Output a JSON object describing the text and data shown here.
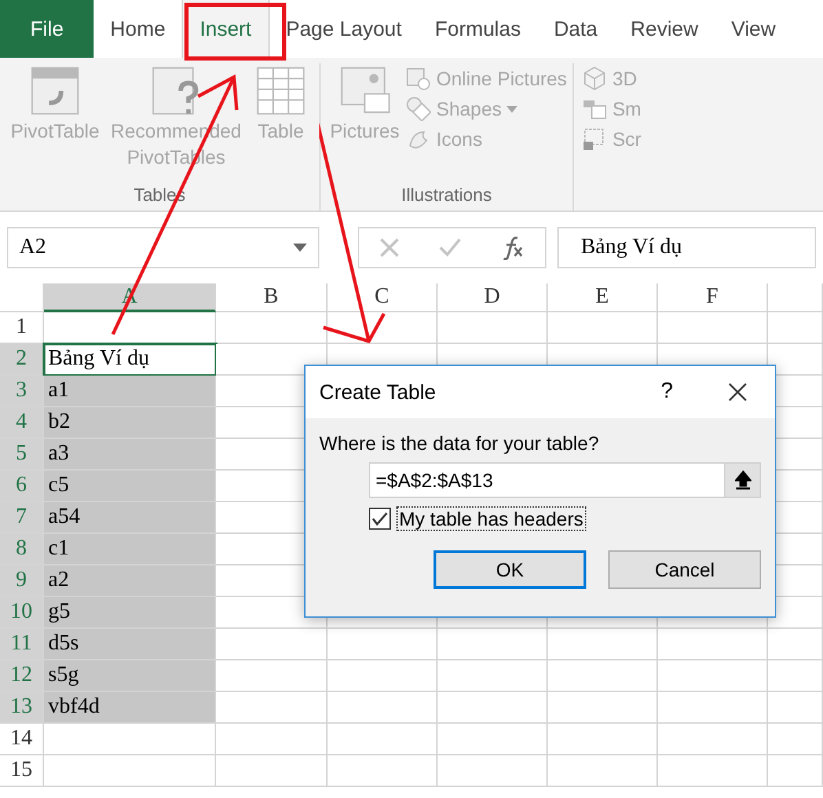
{
  "tabs": [
    {
      "label": "File",
      "kind": "file",
      "selected": false
    },
    {
      "label": "Home",
      "kind": "tab",
      "selected": false
    },
    {
      "label": "Insert",
      "kind": "tab",
      "selected": true
    },
    {
      "label": "Page Layout",
      "kind": "tab",
      "selected": false
    },
    {
      "label": "Formulas",
      "kind": "tab",
      "selected": false
    },
    {
      "label": "Data",
      "kind": "tab",
      "selected": false
    },
    {
      "label": "Review",
      "kind": "tab",
      "selected": false
    },
    {
      "label": "View",
      "kind": "tab",
      "selected": false
    }
  ],
  "ribbon": {
    "groups": [
      {
        "label": "Tables",
        "items": [
          {
            "label": "PivotTable",
            "kind": "pivot"
          },
          {
            "label": "Recommended PivotTables",
            "kind": "recommended"
          },
          {
            "label": "Table",
            "kind": "table"
          }
        ]
      },
      {
        "label": "Illustrations",
        "items": [
          {
            "label": "Pictures",
            "kind": "pictures"
          }
        ],
        "small_items": [
          {
            "label": "Online Pictures",
            "kind": "online",
            "dropdown": false
          },
          {
            "label": "Shapes",
            "kind": "shapes",
            "dropdown": true
          },
          {
            "label": "Icons",
            "kind": "icons",
            "dropdown": false
          }
        ]
      }
    ],
    "cut_items": [
      {
        "label": "3D",
        "kind": "cube"
      },
      {
        "label": "Sm",
        "kind": "smart"
      },
      {
        "label": "Scr",
        "kind": "screenshot"
      }
    ]
  },
  "name_box": "A2",
  "formula": "Bảng Ví dụ",
  "columns": [
    "A",
    "B",
    "C",
    "D",
    "E",
    "F"
  ],
  "rows": [
    {
      "number": "1",
      "value": "",
      "selected": false
    },
    {
      "number": "2",
      "value": "Bảng Ví dụ",
      "selected": false
    },
    {
      "number": "3",
      "value": "a1",
      "selected": true
    },
    {
      "number": "4",
      "value": "b2",
      "selected": true
    },
    {
      "number": "5",
      "value": "a3",
      "selected": true
    },
    {
      "number": "6",
      "value": "c5",
      "selected": true
    },
    {
      "number": "7",
      "value": "a54",
      "selected": true
    },
    {
      "number": "8",
      "value": "c1",
      "selected": true
    },
    {
      "number": "9",
      "value": "a2",
      "selected": true
    },
    {
      "number": "10",
      "value": "g5",
      "selected": true
    },
    {
      "number": "11",
      "value": "d5s",
      "selected": true
    },
    {
      "number": "12",
      "value": "s5g",
      "selected": true
    },
    {
      "number": "13",
      "value": "vbf4d",
      "selected": true
    },
    {
      "number": "14",
      "value": "",
      "selected": false
    },
    {
      "number": "15",
      "value": "",
      "selected": false
    }
  ],
  "dialog": {
    "title": "Create Table",
    "help": "?",
    "prompt": "Where is the data for your table?",
    "range": "=$A$2:$A$13",
    "headers_checkbox": {
      "label": "My table has headers",
      "checked": true
    },
    "buttons": [
      {
        "label": "OK",
        "default": true
      },
      {
        "label": "Cancel",
        "default": false
      }
    ]
  }
}
